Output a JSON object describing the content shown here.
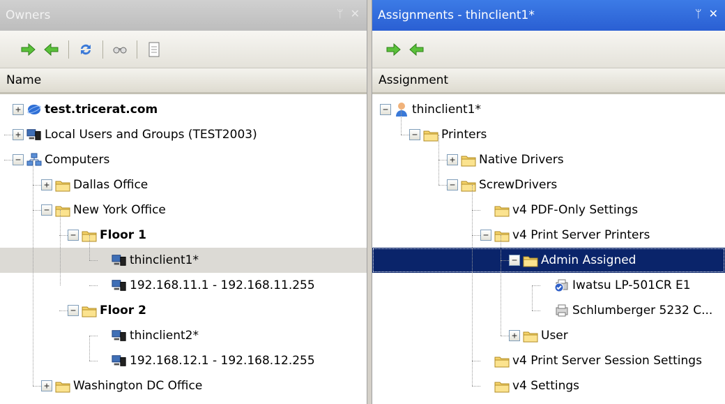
{
  "owners": {
    "title": "Owners",
    "column_header": "Name",
    "toolbar": [
      "assign-right-icon",
      "assign-left-icon",
      "refresh-icon",
      "find-icon",
      "properties-icon"
    ],
    "tree": [
      {
        "label": "test.tricerat.com",
        "bold": true,
        "icon": "domain-icon",
        "exp": "+"
      },
      {
        "label": "Local Users and Groups (TEST2003)",
        "icon": "computer-group-icon",
        "exp": "+"
      },
      {
        "label": "Computers",
        "icon": "network-icon",
        "exp": "−"
      },
      {
        "label": "Dallas Office",
        "icon": "folder-icon",
        "exp": "+"
      },
      {
        "label": "New York Office",
        "icon": "folder-icon",
        "exp": "−"
      },
      {
        "label": "Floor 1",
        "bold": true,
        "icon": "folder-icon",
        "exp": "−"
      },
      {
        "label": "thinclient1*",
        "icon": "computer-icon",
        "selected": true
      },
      {
        "label": "192.168.11.1 - 192.168.11.255",
        "icon": "computer-icon"
      },
      {
        "label": "Floor 2",
        "bold": true,
        "icon": "folder-icon",
        "exp": "−"
      },
      {
        "label": "thinclient2*",
        "icon": "computer-icon"
      },
      {
        "label": "192.168.12.1 - 192.168.12.255",
        "icon": "computer-icon"
      },
      {
        "label": "Washington DC Office",
        "icon": "folder-icon",
        "exp": "+"
      }
    ]
  },
  "assignments": {
    "title": "Assignments - thinclient1*",
    "column_header": "Assignment",
    "toolbar": [
      "assign-right-icon",
      "assign-left-icon"
    ],
    "tree": [
      {
        "label": "thinclient1*",
        "icon": "user-icon",
        "exp": "−"
      },
      {
        "label": "Printers",
        "icon": "folder-icon",
        "exp": "−"
      },
      {
        "label": "Native Drivers",
        "icon": "folder-icon",
        "exp": "+"
      },
      {
        "label": "ScrewDrivers",
        "icon": "folder-icon",
        "exp": "−"
      },
      {
        "label": "v4 PDF-Only Settings",
        "icon": "folder-icon"
      },
      {
        "label": "v4 Print Server Printers",
        "icon": "folder-icon",
        "exp": "−"
      },
      {
        "label": "Admin Assigned",
        "icon": "folder-icon",
        "exp": "−",
        "selected": true
      },
      {
        "label": "Iwatsu LP-501CR E1",
        "icon": "printer-default-icon"
      },
      {
        "label": "Schlumberger 5232 C...",
        "icon": "printer-icon"
      },
      {
        "label": "User",
        "icon": "folder-icon",
        "exp": "+"
      },
      {
        "label": "v4 Print Server Session Settings",
        "icon": "folder-icon"
      },
      {
        "label": "v4 Settings",
        "icon": "folder-icon"
      }
    ]
  },
  "pin_glyph": "ᛘ",
  "close_glyph": "✕",
  "colors": {
    "selection": "#0a246a",
    "active_title": "#2a5fd3",
    "folder": "#f5d36a"
  }
}
